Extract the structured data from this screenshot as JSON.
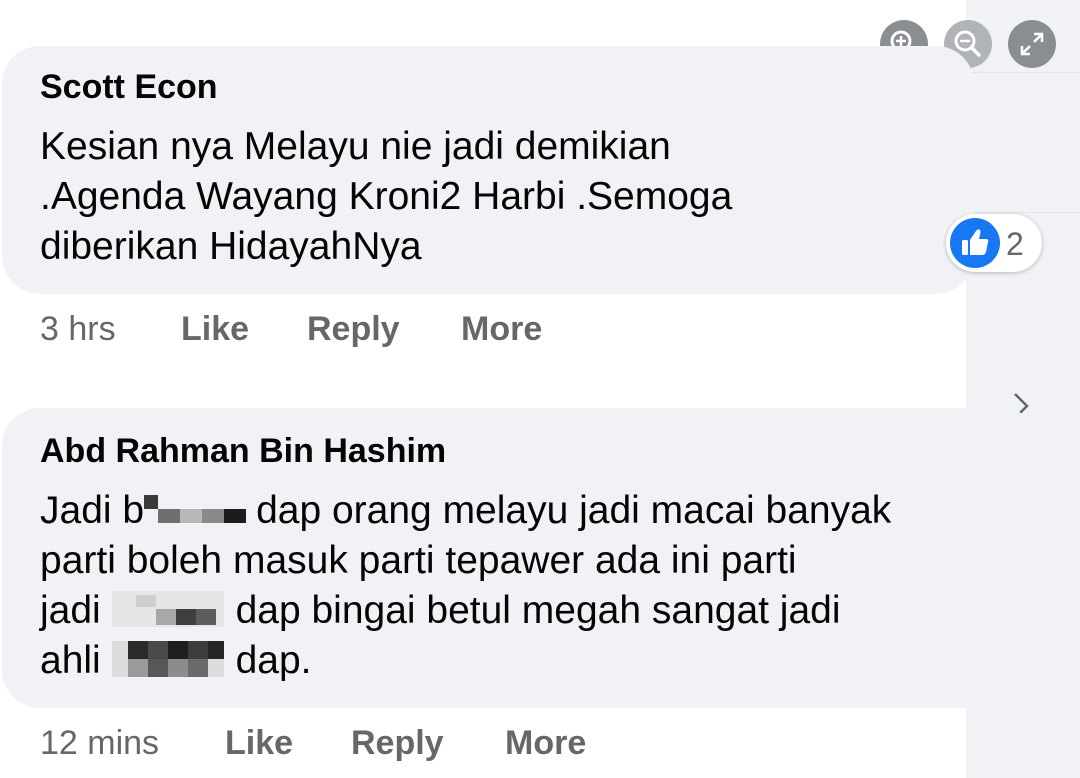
{
  "toolbar": {
    "zoom_in_icon": "zoom-in-icon",
    "zoom_out_icon": "zoom-out-icon",
    "fullscreen_icon": "expand-icon"
  },
  "comments": [
    {
      "author": "Scott Econ",
      "text_lines": [
        "Kesian nya Melayu nie jadi demikian",
        ".Agenda Wayang Kroni2 Harbi .Semoga",
        "diberikan HidayahNya"
      ],
      "time": "3 hrs",
      "like_label": "Like",
      "reply_label": "Reply",
      "more_label": "More",
      "reaction": {
        "icon": "thumbs-up-icon",
        "count": "2"
      }
    },
    {
      "author": "Abd Rahman Bin Hashim",
      "text_lines": [
        {
          "before": "Jadi b",
          "after": "dap orang melayu jadi macai banyak"
        },
        "parti boleh masuk parti tepawer ada ini parti",
        {
          "before": "jadi",
          "after": "dap bingai betul megah sangat jadi"
        },
        {
          "before": "ahli",
          "after": "dap."
        }
      ],
      "time": "12 mins",
      "like_label": "Like",
      "reply_label": "Reply",
      "more_label": "More"
    }
  ],
  "colors": {
    "bubble": "#f0f2f5",
    "meta_text": "#65676b",
    "like_blue": "#1877f2",
    "tool_button": "#8a8d91"
  }
}
